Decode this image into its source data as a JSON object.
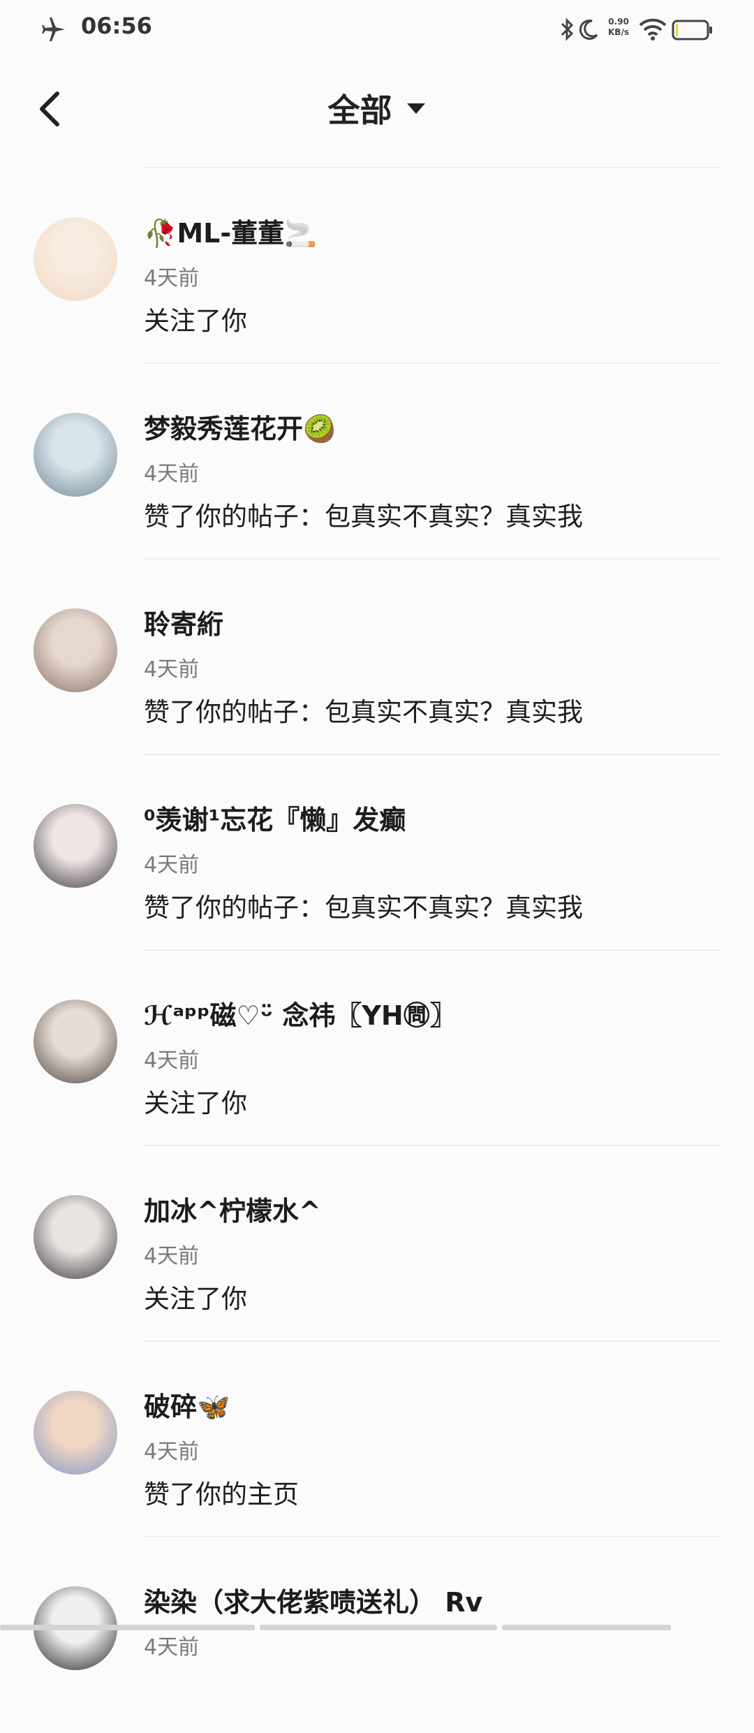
{
  "status_bar": {
    "time": "06:56",
    "net_speed_value": "0.90",
    "net_speed_unit": "KB/s",
    "icons": [
      "airplane-icon",
      "bluetooth-icon",
      "moon-icon",
      "wifi-icon",
      "battery-icon"
    ]
  },
  "nav": {
    "title": "全部",
    "back_icon": "chevron-left-icon",
    "dropdown_icon": "caret-down-icon"
  },
  "notifications": [
    {
      "name": "🥀ML-董董🚬",
      "time": "4天前",
      "action": "关注了你",
      "avatar_colors": [
        "#f7ecdf",
        "#f2d9c4"
      ]
    },
    {
      "name": "梦毅秀莲花开🥝",
      "time": "4天前",
      "action": "赞了你的帖子：包真实不真实？真实我",
      "avatar_colors": [
        "#d9e4ea",
        "#6f8796"
      ]
    },
    {
      "name": "聆寄絎",
      "time": "4天前",
      "action": "赞了你的帖子：包真实不真实？真实我",
      "avatar_colors": [
        "#e6d8cf",
        "#8a7266"
      ]
    },
    {
      "name": "⁰羡谢¹忘花『懒』发癫",
      "time": "4天前",
      "action": "赞了你的帖子：包真实不真实？真实我",
      "avatar_colors": [
        "#efe6e3",
        "#3a3540"
      ]
    },
    {
      "name": "ℋᵃᵖᵖ磁♡ᵕ̈ 念祎〖YH㉄〗",
      "time": "4天前",
      "action": "关注了你",
      "avatar_colors": [
        "#e6ddd6",
        "#4c4240"
      ]
    },
    {
      "name": "加冰^柠檬水^",
      "time": "4天前",
      "action": "关注了你",
      "avatar_colors": [
        "#e8e4e2",
        "#3b3436"
      ]
    },
    {
      "name": "破碎🦋",
      "time": "4天前",
      "action": "赞了你的主页",
      "avatar_colors": [
        "#f2d6c4",
        "#7c98c6"
      ]
    },
    {
      "name": "染染（求大佬紫啧送礼） Rv",
      "time": "4天前",
      "action": "",
      "avatar_colors": [
        "#f0efef",
        "#222222"
      ]
    }
  ]
}
